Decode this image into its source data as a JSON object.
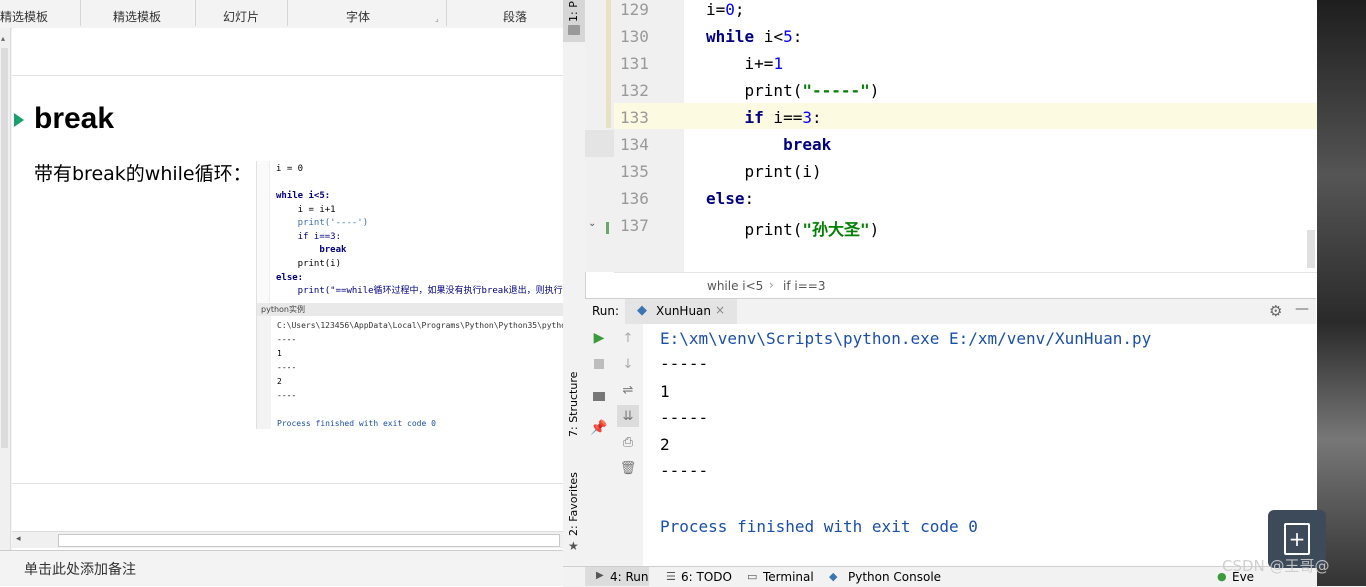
{
  "ppt": {
    "ribbon": {
      "groups": [
        "精选模板",
        "精选模板",
        "幻灯片",
        "字体",
        "段落"
      ]
    },
    "slide": {
      "heading": "break",
      "caption": "带有break的while循环：",
      "code_lines": [
        "i = 0",
        "",
        "while i<5:",
        "    i = i+1",
        "    print('----')",
        "    if i==3:",
        "        break",
        "    print(i)",
        "else:",
        "    print(\"==while循环过程中，如果没有执行break退出，则执行"
      ],
      "run_label": "python实例",
      "output_lines": [
        "C:\\Users\\123456\\AppData\\Local\\Programs\\Python\\Python35\\pytho",
        "----",
        "1",
        "----",
        "2",
        "----",
        "",
        "Process finished with exit code 0"
      ]
    },
    "notes_placeholder": "单击此处添加备注"
  },
  "pycharm": {
    "left_tab_project": "1: P",
    "left_tab_structure": "7: Structure",
    "left_tab_favorites": "2: Favorites",
    "editor": {
      "line_numbers": [
        "129",
        "130",
        "131",
        "132",
        "133",
        "134",
        "135",
        "136",
        "137"
      ],
      "highlighted_line": "133",
      "breadcrumb": [
        "while i<5",
        "if i==3"
      ]
    },
    "run": {
      "label": "Run:",
      "config_name": "XunHuan",
      "output": [
        "E:\\xm\\venv\\Scripts\\python.exe E:/xm/venv/XunHuan.py",
        "-----",
        "1",
        "-----",
        "2",
        "-----",
        "",
        "Process finished with exit code 0"
      ]
    },
    "statusbar": {
      "run_tab": "4: Run",
      "todo_tab": "6: TODO",
      "terminal_tab": "Terminal",
      "console_tab": "Python Console",
      "event_log": "Eve"
    }
  },
  "watermark": "CSDN @王哥@",
  "colors": {
    "keyword": "#000080",
    "string": "#008000",
    "number": "#0000ff",
    "current_line": "#fcfae1",
    "run_green": "#3c9a3c"
  }
}
